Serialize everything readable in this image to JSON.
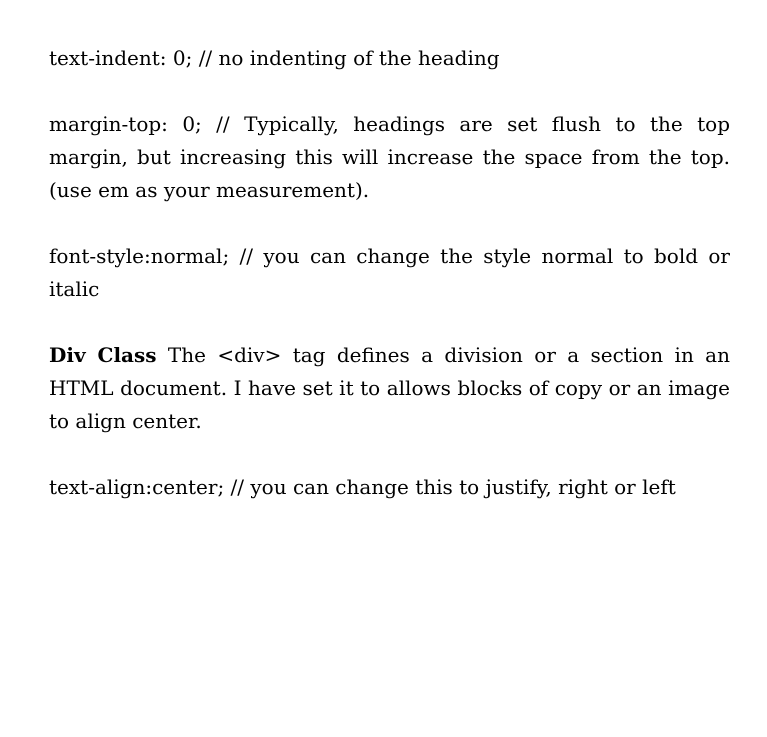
{
  "paragraphs": {
    "text_indent": "text-indent: 0; // no indenting of the heading",
    "margin_top": "margin-top: 0; // Typically, headings are set flush to the top margin, but increasing this will increase the space from the top. (use em as your measurement).",
    "font_style": "font-style:normal; // you can change the style normal to bold or italic",
    "div_class": {
      "term": "Div Class",
      "text": " The <div> tag defines a division or a section in an HTML document. I have set it to allows blocks of copy or an image to align center."
    },
    "text_align": "text-align:center; // you can change this to justify, right or left"
  }
}
